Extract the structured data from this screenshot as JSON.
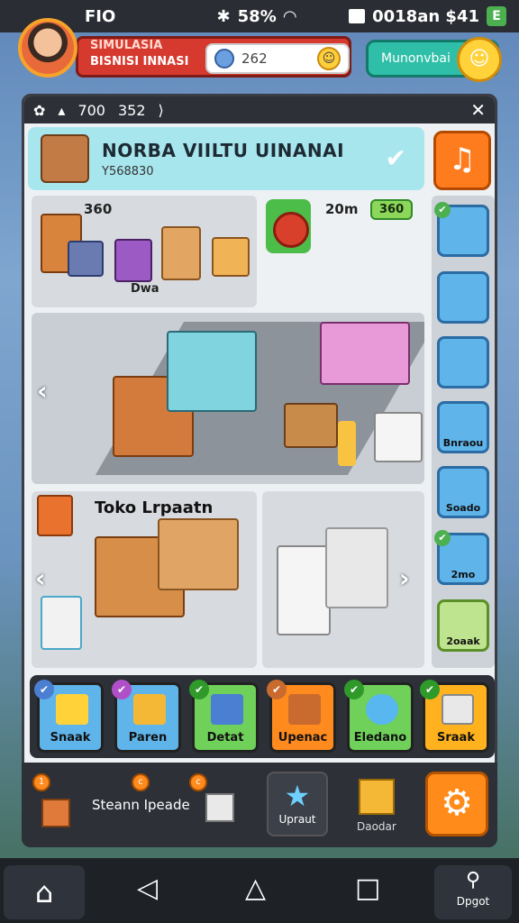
{
  "status_bar": {
    "left": "FIO",
    "signal": "58%",
    "right_text": "0018an $41",
    "green_icon": "E"
  },
  "header": {
    "title_line1": "SIMULASIA",
    "title_line2": "BISNISI INNASI",
    "money_value": "262",
    "money_button": "Munonvbai"
  },
  "panel_top": {
    "stat1": "700",
    "stat2": "352",
    "close": "X"
  },
  "store": {
    "name": "NORBA VIILTU UINANAI",
    "subtitle": "Y568830"
  },
  "cells": {
    "a_value": "360",
    "a_label": "Dwa",
    "b_value": "20m",
    "b_badge": "360",
    "d_label": "Toko Lrpaatn"
  },
  "sidebar": [
    {
      "label": "",
      "check": true
    },
    {
      "label": "",
      "check": false
    },
    {
      "label": "",
      "check": false
    },
    {
      "label": "Bnraou",
      "check": false
    },
    {
      "label": "Soado",
      "check": false
    },
    {
      "label": "2mo",
      "check": true
    },
    {
      "label": "2oaak",
      "check": false
    }
  ],
  "products": [
    {
      "label": "Snaak",
      "bg": "#5fb4ea",
      "box": "#ffd23a"
    },
    {
      "label": "Paren",
      "bg": "#5fb4ea",
      "box": "#f4b836"
    },
    {
      "label": "Detat",
      "bg": "#6fd05a",
      "box": "#4a7fd1"
    },
    {
      "label": "Upenac",
      "bg": "#ff8a1e",
      "box": "#c96b2e"
    },
    {
      "label": "Eledano",
      "bg": "#6fd05a",
      "box": "#58b7ef"
    },
    {
      "label": "Sraak",
      "bg": "#ffb21e",
      "box": "#e8e8e8"
    }
  ],
  "action_bar": {
    "label": "Steann Ipeade",
    "upgrade_label": "Upraut",
    "gold_label": "Daodar",
    "dot1": "1",
    "dot2": "c",
    "dot3": "c"
  },
  "nav": {
    "search_label": "Dpgot"
  },
  "colors": {
    "accent": "#ff8c1a",
    "panel": "#eef1f4",
    "dark": "#2d3037",
    "title_red": "#d63a2f"
  }
}
